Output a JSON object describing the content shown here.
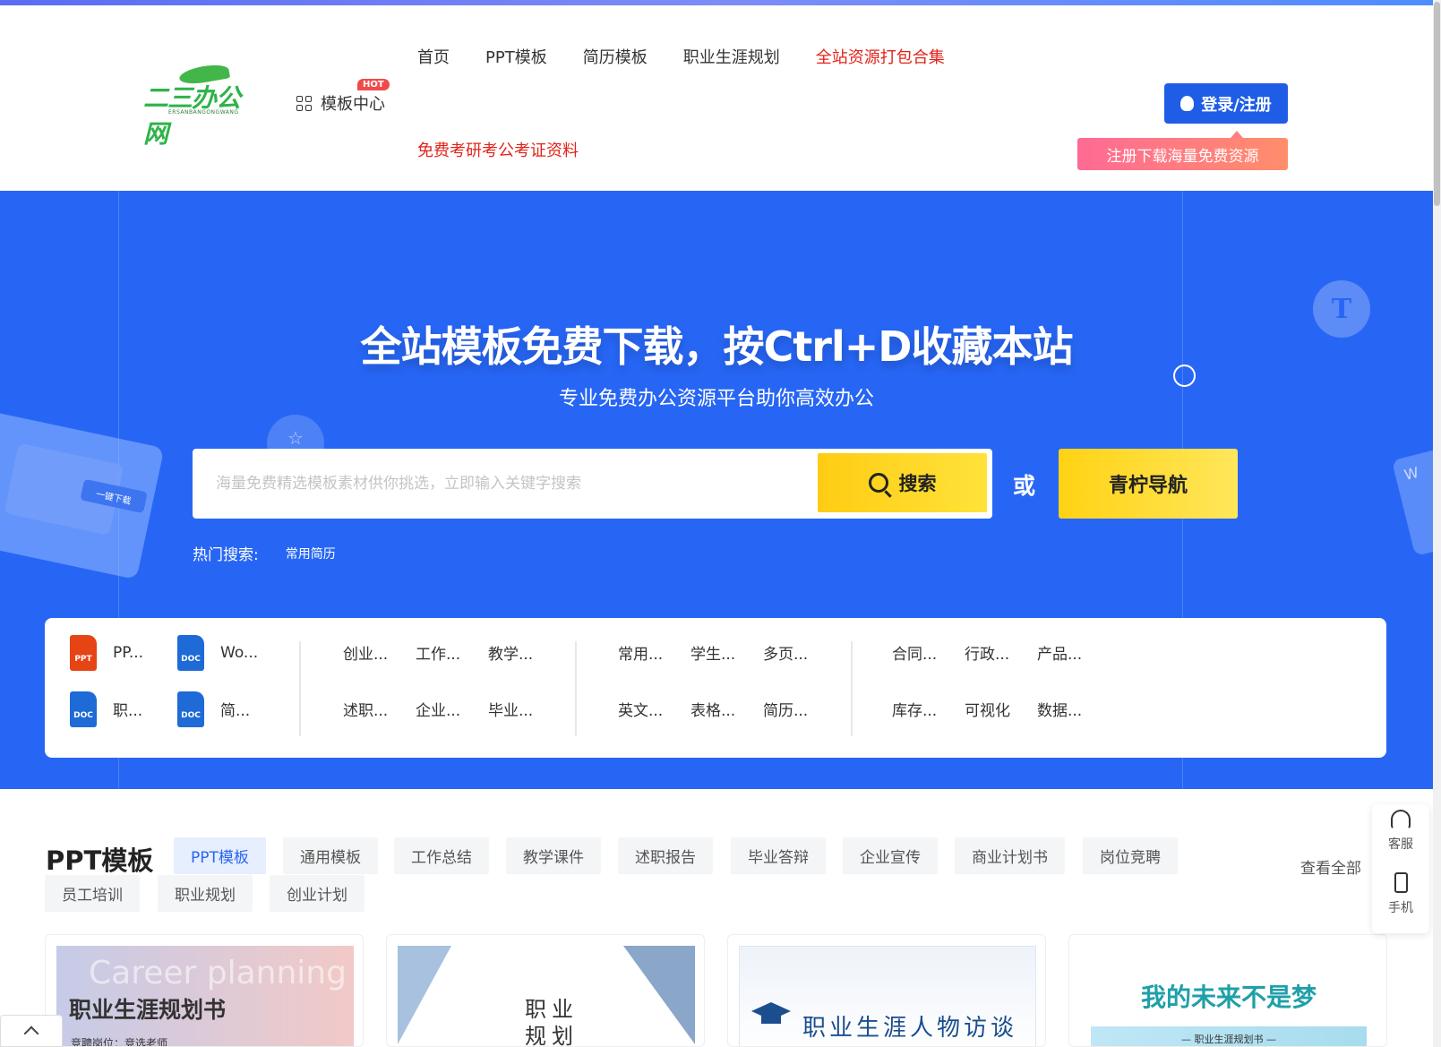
{
  "header": {
    "logo_text": "二三办公网",
    "logo_sub": "ERSANBANGONGWANG",
    "template_center": "模板中心",
    "hot_badge": "HOT",
    "nav": [
      "首页",
      "PPT模板",
      "简历模板",
      "职业生涯规划",
      "全站资源打包合集"
    ],
    "nav_second": "免费考研考公考证资料",
    "login_label": "登录/注册",
    "register_banner": "注册下载海量免费资源"
  },
  "hero": {
    "title": "全站模板免费下载，按Ctrl+D收藏本站",
    "subtitle": "专业免费办公资源平台助你高效办公",
    "search_placeholder": "海量免费精选模板素材供你挑选，立即输入关键字搜索",
    "search_button": "搜索",
    "or_text": "或",
    "nav_button": "青柠导航",
    "hot_search_label": "热门搜索:",
    "hot_search_keyword": "常用简历",
    "deco_letter": "T",
    "deco_card_tag": "一键下载",
    "deco_right_text": "W"
  },
  "categories": {
    "files": [
      {
        "type": "PPT",
        "label": "PP..."
      },
      {
        "type": "DOC",
        "label": "Wo..."
      },
      {
        "type": "DOC",
        "label": "职..."
      },
      {
        "type": "DOC",
        "label": "简..."
      }
    ],
    "group1": [
      "创业...",
      "工作...",
      "教学...",
      "述职...",
      "企业...",
      "毕业..."
    ],
    "group2": [
      "常用...",
      "学生...",
      "多页...",
      "英文...",
      "表格...",
      "简历..."
    ],
    "group3": [
      "合同...",
      "行政...",
      "产品...",
      "库存...",
      "可视化",
      "数据..."
    ]
  },
  "ppt_section": {
    "title": "PPT模板",
    "tabs": [
      "PPT模板",
      "通用模板",
      "工作总结",
      "教学课件",
      "述职报告",
      "毕业答辩",
      "企业宣传",
      "商业计划书",
      "岗位竞聘",
      "员工培训",
      "职业规划",
      "创业计划"
    ],
    "active_tab": "PPT模板",
    "view_all": "查看全部"
  },
  "cards": [
    {
      "bg_word": "Career planning",
      "title": "职业生涯规划书",
      "sub": "竞聘岗位：竞选老师"
    },
    {
      "title": "职业\n规划"
    },
    {
      "title": "职业生涯人物访谈"
    },
    {
      "title": "我的未来不是梦",
      "sub": "— 职业生涯规划书 —"
    }
  ],
  "side": {
    "service": "客服",
    "mobile": "手机"
  },
  "colors": {
    "brand_blue": "#2766f5",
    "accent_red": "#e2231a",
    "search_yellow": "#ffcc13"
  }
}
